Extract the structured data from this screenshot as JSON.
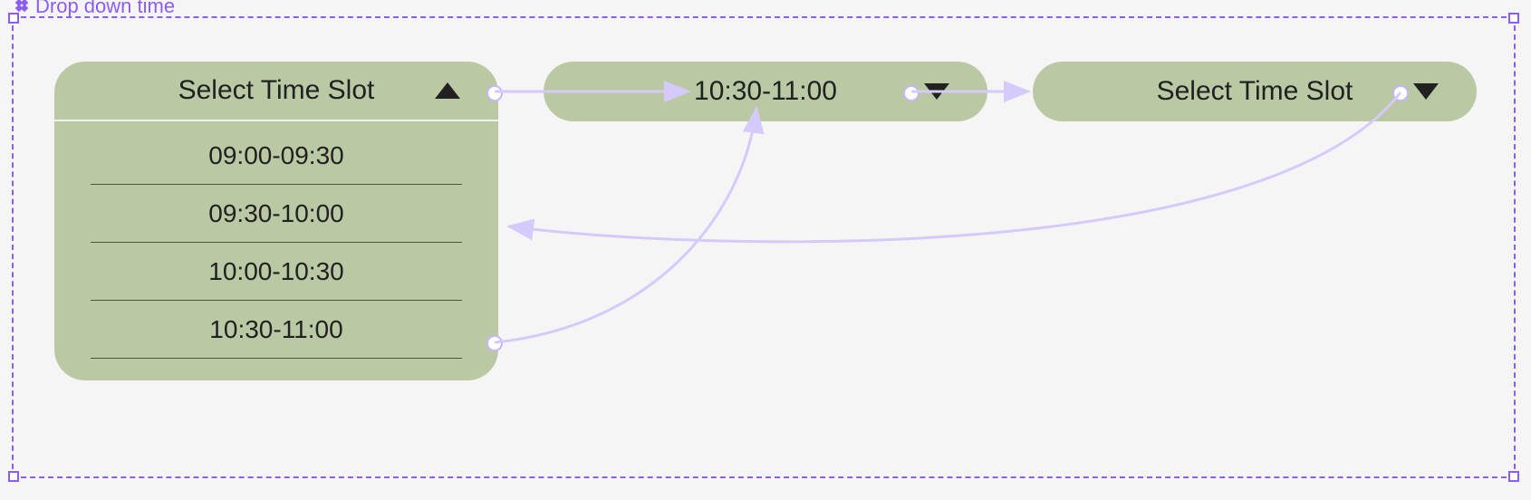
{
  "component": {
    "label": "Drop down time",
    "icon": "component-diamond-icon"
  },
  "colors": {
    "accent_purple": "#8b5cf6",
    "connection_purple": "#d6c9fb",
    "pill_bg": "#bbc8a4",
    "divider": "#4a5a2b",
    "text": "#212121"
  },
  "dropdowns": [
    {
      "id": "dd1",
      "state": "open",
      "header_label": "Select Time Slot",
      "caret": "up",
      "options": [
        "09:00-09:30",
        "09:30-10:00",
        "10:00-10:30",
        "10:30-11:00"
      ]
    },
    {
      "id": "dd2",
      "state": "closed",
      "header_label": "10:30-11:00",
      "caret": "down"
    },
    {
      "id": "dd3",
      "state": "closed",
      "header_label": "Select Time Slot",
      "caret": "down"
    }
  ],
  "connections": [
    {
      "from": "dd1-header-node",
      "to": "dd2-header"
    },
    {
      "from": "dd2-header-node",
      "to": "dd3-header"
    },
    {
      "from": "dd3-header-node",
      "to": "dd1-header-area"
    },
    {
      "from": "dd1-option-4-node",
      "to": "dd2-header"
    }
  ]
}
